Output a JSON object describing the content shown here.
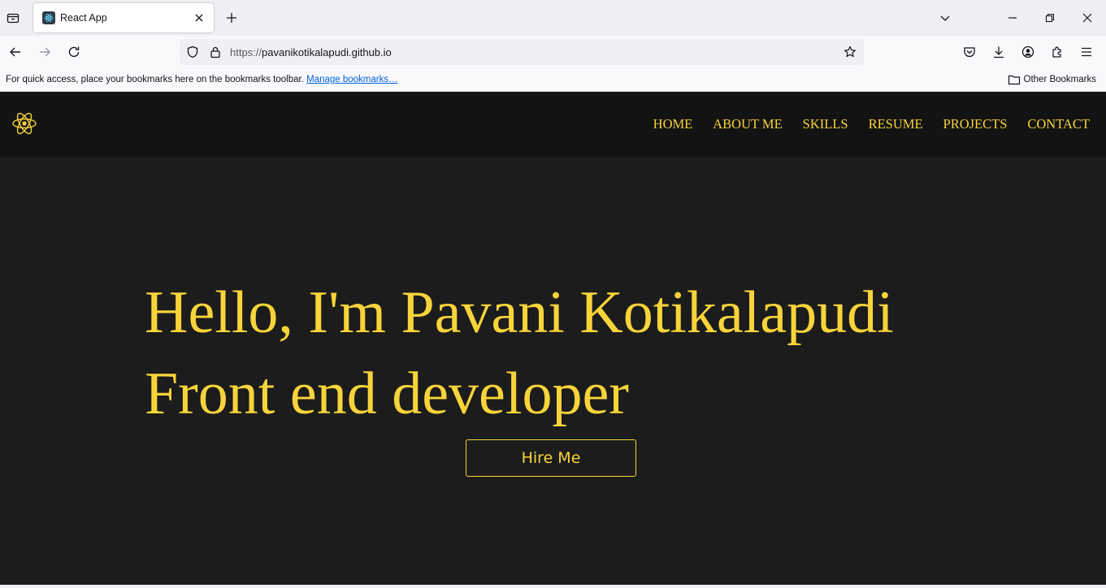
{
  "browser": {
    "tab": {
      "title": "React App"
    },
    "url": {
      "scheme": "https://",
      "host": "pavanikotikalapudi.github.io"
    },
    "bookmarks_bar": {
      "message": "For quick access, place your bookmarks here on the bookmarks toolbar.",
      "manage_link": "Manage bookmarks…",
      "other_bookmarks": "Other Bookmarks"
    },
    "icons": {
      "tab_list": "tab-list-icon",
      "new_tab": "plus-icon",
      "back": "arrow-left-icon",
      "forward": "arrow-right-icon",
      "reload": "reload-icon",
      "shield": "shield-icon",
      "lock": "lock-icon",
      "bookmark_star": "star-icon",
      "pocket": "pocket-icon",
      "downloads": "download-icon",
      "account": "account-icon",
      "extensions": "extensions-icon",
      "menu": "hamburger-menu-icon"
    }
  },
  "site": {
    "nav": [
      "HOME",
      "ABOUT ME",
      "SKILLS",
      "RESUME",
      "PROJECTS",
      "CONTACT"
    ],
    "hero": {
      "line1": "Hello, I'm Pavani Kotikalapudi",
      "line2": "Front end developer",
      "button": "Hire Me"
    },
    "colors": {
      "accent": "#f8d43a",
      "background": "#1c1c1c",
      "header": "#131313"
    }
  }
}
